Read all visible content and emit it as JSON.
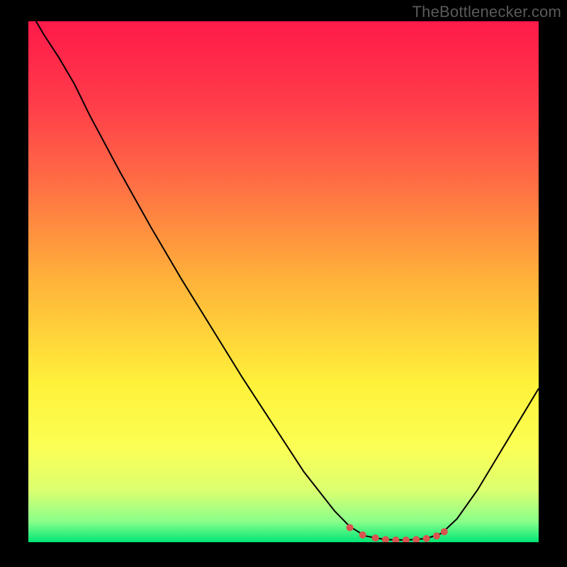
{
  "attribution": "TheBottlenecker.com",
  "chart_data": {
    "type": "line",
    "title": "",
    "xlabel": "",
    "ylabel": "",
    "xlim": [
      0,
      100
    ],
    "ylim": [
      0,
      100
    ],
    "background": {
      "type": "vertical-gradient",
      "stops": [
        {
          "offset": 0.0,
          "color": "#ff1a4a"
        },
        {
          "offset": 0.15,
          "color": "#ff3a4a"
        },
        {
          "offset": 0.3,
          "color": "#ff6a45"
        },
        {
          "offset": 0.5,
          "color": "#ffb33a"
        },
        {
          "offset": 0.7,
          "color": "#fff23a"
        },
        {
          "offset": 0.82,
          "color": "#fbff55"
        },
        {
          "offset": 0.9,
          "color": "#dcff70"
        },
        {
          "offset": 0.96,
          "color": "#8aff8a"
        },
        {
          "offset": 1.0,
          "color": "#00e676"
        }
      ]
    },
    "series": [
      {
        "name": "bottleneck-curve",
        "color": "#000000",
        "stroke_width": 2,
        "points": [
          {
            "x": 1.5,
            "y": 100.0
          },
          {
            "x": 3.0,
            "y": 97.5
          },
          {
            "x": 6.0,
            "y": 93.0
          },
          {
            "x": 9.0,
            "y": 88.0
          },
          {
            "x": 12.0,
            "y": 82.0
          },
          {
            "x": 18.0,
            "y": 71.0
          },
          {
            "x": 24.0,
            "y": 60.5
          },
          {
            "x": 30.0,
            "y": 50.5
          },
          {
            "x": 36.0,
            "y": 41.0
          },
          {
            "x": 42.0,
            "y": 31.5
          },
          {
            "x": 48.0,
            "y": 22.5
          },
          {
            "x": 54.0,
            "y": 13.5
          },
          {
            "x": 60.0,
            "y": 6.0
          },
          {
            "x": 63.0,
            "y": 3.0
          },
          {
            "x": 66.0,
            "y": 1.2
          },
          {
            "x": 70.0,
            "y": 0.5
          },
          {
            "x": 74.0,
            "y": 0.4
          },
          {
            "x": 78.0,
            "y": 0.7
          },
          {
            "x": 81.0,
            "y": 1.7
          },
          {
            "x": 84.0,
            "y": 4.5
          },
          {
            "x": 88.0,
            "y": 10.0
          },
          {
            "x": 92.0,
            "y": 16.5
          },
          {
            "x": 96.0,
            "y": 23.0
          },
          {
            "x": 100.0,
            "y": 29.5
          }
        ]
      },
      {
        "name": "optimal-range-markers",
        "color": "#d9534f",
        "marker_radius": 5,
        "points": [
          {
            "x": 63.0,
            "y": 2.8
          },
          {
            "x": 65.5,
            "y": 1.4
          },
          {
            "x": 68.0,
            "y": 0.8
          },
          {
            "x": 70.0,
            "y": 0.5
          },
          {
            "x": 72.0,
            "y": 0.4
          },
          {
            "x": 74.0,
            "y": 0.4
          },
          {
            "x": 76.0,
            "y": 0.5
          },
          {
            "x": 78.0,
            "y": 0.7
          },
          {
            "x": 80.0,
            "y": 1.2
          },
          {
            "x": 81.5,
            "y": 2.0
          }
        ]
      }
    ]
  }
}
